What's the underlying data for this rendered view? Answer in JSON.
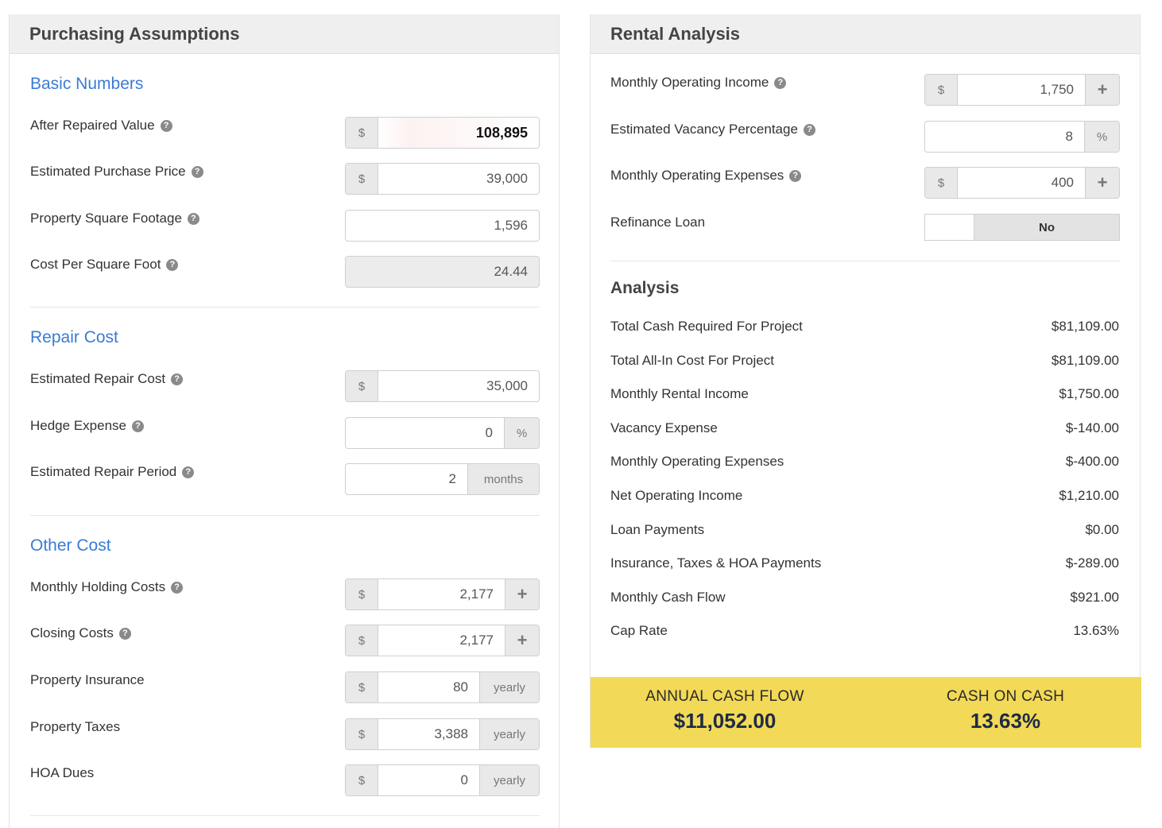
{
  "purchasing": {
    "title": "Purchasing Assumptions",
    "basic": {
      "title": "Basic Numbers",
      "arv": {
        "label": "After Repaired Value",
        "prefix": "$",
        "value": "108,895"
      },
      "purchase_price": {
        "label": "Estimated Purchase Price",
        "prefix": "$",
        "value": "39,000"
      },
      "sqft": {
        "label": "Property Square Footage",
        "value": "1,596"
      },
      "cost_sqft": {
        "label": "Cost Per Square Foot",
        "value": "24.44"
      }
    },
    "repair": {
      "title": "Repair Cost",
      "repair_cost": {
        "label": "Estimated Repair Cost",
        "prefix": "$",
        "value": "35,000"
      },
      "hedge": {
        "label": "Hedge Expense",
        "value": "0",
        "suffix": "%"
      },
      "period": {
        "label": "Estimated Repair Period",
        "value": "2",
        "suffix": "months"
      }
    },
    "other": {
      "title": "Other Cost",
      "holding": {
        "label": "Monthly Holding Costs",
        "prefix": "$",
        "value": "2,177",
        "button": "+"
      },
      "closing": {
        "label": "Closing Costs",
        "prefix": "$",
        "value": "2,177",
        "button": "+"
      },
      "insurance": {
        "label": "Property Insurance",
        "prefix": "$",
        "value": "80",
        "suffix": "yearly"
      },
      "taxes": {
        "label": "Property Taxes",
        "prefix": "$",
        "value": "3,388",
        "suffix": "yearly"
      },
      "hoa": {
        "label": "HOA Dues",
        "prefix": "$",
        "value": "0",
        "suffix": "yearly"
      }
    },
    "help_glyph": "?"
  },
  "rental": {
    "title": "Rental Analysis",
    "income": {
      "label": "Monthly Operating Income",
      "prefix": "$",
      "value": "1,750",
      "button": "+"
    },
    "vacancy": {
      "label": "Estimated Vacancy Percentage",
      "value": "8",
      "suffix": "%"
    },
    "expenses": {
      "label": "Monthly Operating Expenses",
      "prefix": "$",
      "value": "400",
      "button": "+"
    },
    "refinance": {
      "label": "Refinance Loan",
      "value": "No"
    },
    "analysis": {
      "title": "Analysis",
      "rows": [
        {
          "label": "Total Cash Required For Project",
          "value": "$81,109.00"
        },
        {
          "label": "Total All-In Cost For Project",
          "value": "$81,109.00"
        },
        {
          "label": "Monthly Rental Income",
          "value": "$1,750.00"
        },
        {
          "label": "Vacancy Expense",
          "value": "$-140.00"
        },
        {
          "label": "Monthly Operating Expenses",
          "value": "$-400.00"
        },
        {
          "label": "Net Operating Income",
          "value": "$1,210.00"
        },
        {
          "label": "Loan Payments",
          "value": "$0.00"
        },
        {
          "label": "Insurance, Taxes & HOA Payments",
          "value": "$-289.00"
        },
        {
          "label": "Monthly Cash Flow",
          "value": "$921.00"
        },
        {
          "label": "Cap Rate",
          "value": "13.63%"
        }
      ]
    },
    "summary": {
      "annual_label": "ANNUAL CASH FLOW",
      "annual_value": "$11,052.00",
      "coc_label": "CASH ON CASH",
      "coc_value": "13.63%"
    }
  },
  "colors": {
    "accent": "#3a7bd5",
    "summary_bg": "#f2d957",
    "summary_text": "#1e2a44"
  }
}
